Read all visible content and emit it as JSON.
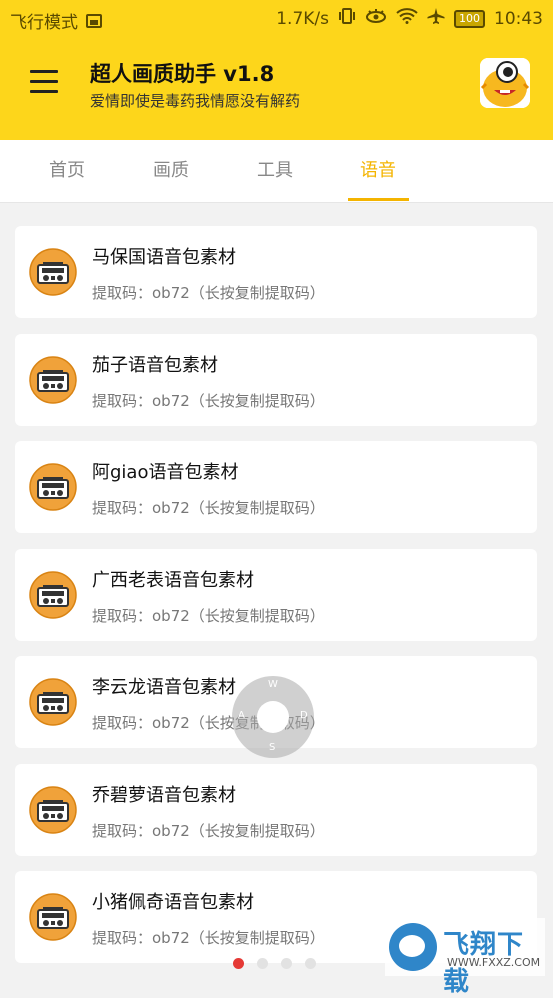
{
  "status_bar": {
    "mode": "飞行模式",
    "speed": "1.7K/s",
    "battery": "100",
    "time": "10:43",
    "icons": [
      "gallery-icon",
      "vibrate-icon",
      "eye-icon",
      "wifi-icon",
      "airplane-icon",
      "battery-icon"
    ]
  },
  "header": {
    "title": "超人画质助手 v1.8",
    "subtitle": "爱情即使是毒药我情愿没有解药",
    "background": "#fdd61b",
    "menu_icon": "hamburger-menu-icon",
    "avatar_icon": "cartoon-avatar-icon"
  },
  "tabs": [
    {
      "label": "首页",
      "active": false
    },
    {
      "label": "画质",
      "active": false
    },
    {
      "label": "工具",
      "active": false
    },
    {
      "label": "语音",
      "active": true
    }
  ],
  "accent_color": "#f4b400",
  "items": [
    {
      "title": "马保国语音包素材",
      "code": "提取码：ob72（长按复制提取码）"
    },
    {
      "title": "茄子语音包素材",
      "code": "提取码：ob72（长按复制提取码）"
    },
    {
      "title": "阿giao语音包素材",
      "code": "提取码：ob72（长按复制提取码）"
    },
    {
      "title": "广西老表语音包素材",
      "code": "提取码：ob72（长按复制提取码）"
    },
    {
      "title": "李云龙语音包素材",
      "code": "提取码：ob72（长按复制提取码）"
    },
    {
      "title": "乔碧萝语音包素材",
      "code": "提取码：ob72（长按复制提取码）"
    },
    {
      "title": "小猪佩奇语音包素材",
      "code": "提取码：ob72（长按复制提取码）"
    }
  ],
  "joystick": {
    "up": "W",
    "left": "A",
    "right": "D",
    "down": "S"
  },
  "pager": {
    "count": 4,
    "active": 1
  },
  "watermark": {
    "text": "飞翔下载",
    "url": "WWW.FXXZ.COM"
  }
}
